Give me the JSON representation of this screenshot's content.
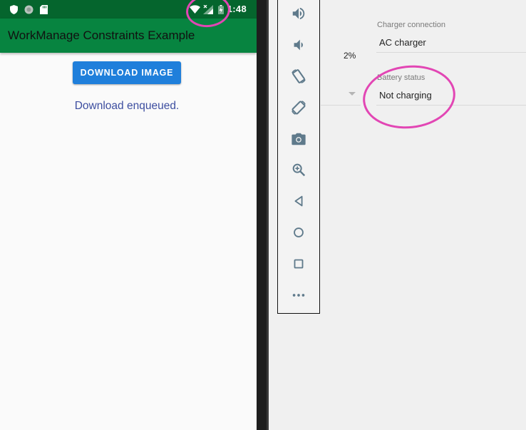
{
  "status_bar": {
    "time": "1:48",
    "icons": [
      "shield-icon",
      "circle-icon",
      "sd-card-icon",
      "wifi-icon",
      "signal-off-icon",
      "battery-charging-icon"
    ]
  },
  "app": {
    "title": "WorkManage Constraints Example",
    "download_button_label": "DOWNLOAD IMAGE",
    "status_message": "Download enqueued."
  },
  "toolbar": {
    "buttons": [
      "volume-up-icon",
      "volume-down-icon",
      "rotate-left-icon",
      "rotate-right-icon",
      "camera-icon",
      "zoom-icon",
      "back-icon",
      "home-icon",
      "overview-icon",
      "more-icon"
    ]
  },
  "battery_panel": {
    "charge_level": "2%",
    "charger_connection": {
      "label": "Charger connection",
      "value": "AC charger"
    },
    "battery_status": {
      "label": "Battery status",
      "value": "Not charging"
    }
  },
  "colors": {
    "status_bar": "#05652d",
    "app_bar": "#078440",
    "button": "#1f7fdb",
    "message_text": "#3d4ea0",
    "annotation": "#e246b4",
    "toolbar_icon": "#5f7a8b"
  }
}
